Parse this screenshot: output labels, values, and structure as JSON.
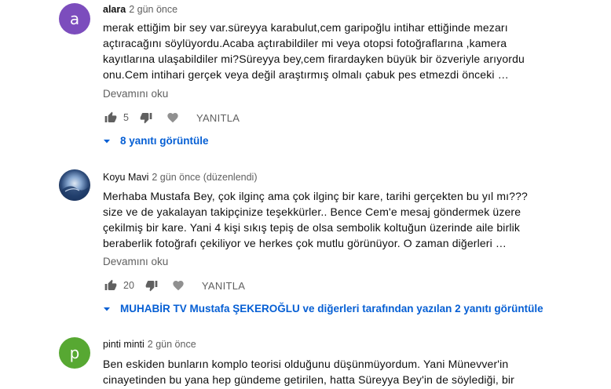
{
  "comments": [
    {
      "avatar_letter": "a",
      "avatar_color": "#7c4dbd",
      "author": "alara",
      "time": "2 gün önce",
      "text": "merak ettiğim bir sey var.süreyya karabulut,cem garipoğlu intihar ettiğinde mezarı\naçtıracağını söylüyordu.Acaba açtırabildiler mi veya otopsi fotoğraflarına ,kamera\nkayıtlarına ulaşabildiler mi?Süreyya bey,cem firardayken büyük bir özveriyle arıyordu\nonu.Cem intihari gerçek veya değil araştırmış olmalı çabuk pes etmezdi önceki …",
      "read_more": "Devamını oku",
      "likes": "5",
      "reply_label": "YANITLA",
      "replies_link": "8 yanıtı görüntüle"
    },
    {
      "avatar_letter": "",
      "author": "Koyu Mavi",
      "time": "2 gün önce (düzenlendi)",
      "text": "Merhaba Mustafa Bey, çok ilginç ama çok ilginç bir kare,  tarihi gerçekten bu yıl mı???\nsize ve de yakalayan  takipçinize teşekkürler.. Bence Cem'e mesaj göndermek üzere\nçekilmiş bir kare. Yani 4 kişi sıkış tepiş de olsa sembolik koltuğun üzerinde aile birlik\nberaberlik fotoğrafı çekiliyor ve herkes çok mutlu görünüyor. O zaman diğerleri …",
      "read_more": "Devamını oku",
      "likes": "20",
      "reply_label": "YANITLA",
      "replies_link": "MUHABİR TV Mustafa ŞEKEROĞLU ve diğerleri tarafından yazılan 2 yanıtı görüntüle"
    },
    {
      "avatar_letter": "p",
      "avatar_color": "#57a832",
      "author": "pinti minti",
      "time": "2 gün önce",
      "text": "Ben eskiden bunların komplo teorisi olduğunu düşünmüyordum. Yani Münevver'in\ncinayetinden bu yana hep gündeme getirilen, hatta Süreyya Bey'in de söylediği, bir"
    }
  ]
}
